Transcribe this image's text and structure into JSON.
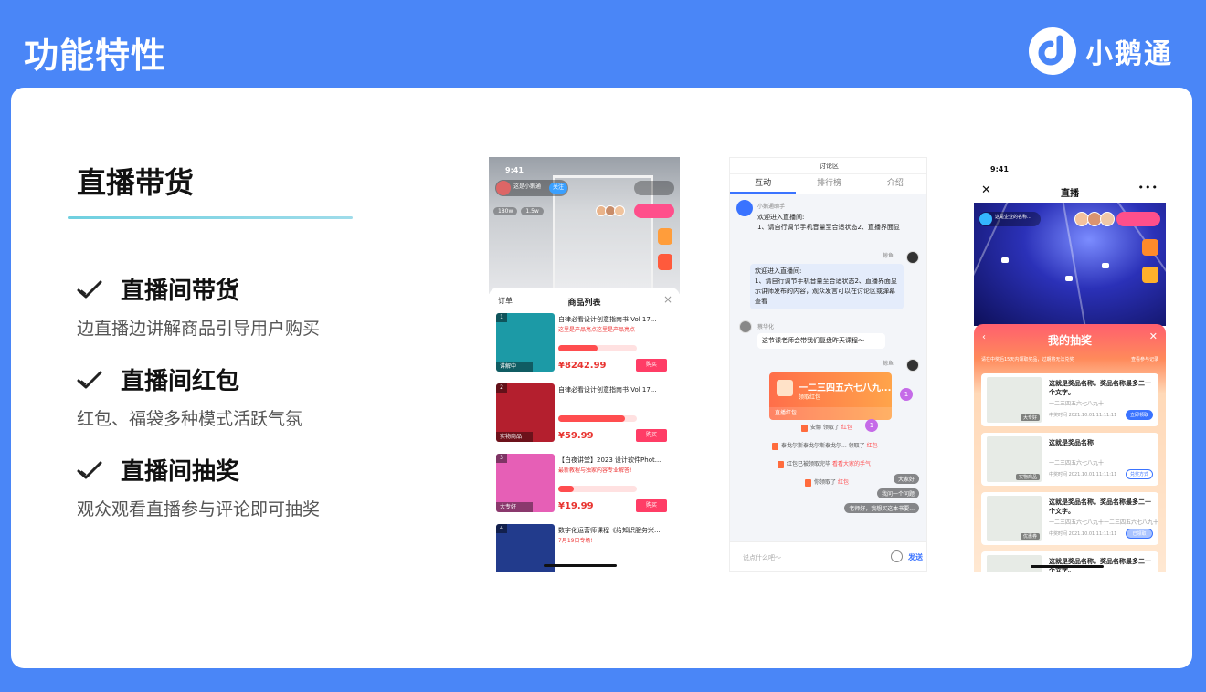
{
  "header": {
    "title": "功能特性",
    "brand_name": "小鹅通"
  },
  "section": {
    "title": "直播带货"
  },
  "features": [
    {
      "title": "直播间带货",
      "desc": "边直播边讲解商品引导用户购买"
    },
    {
      "title": "直播间红包",
      "desc": "红包、福袋多种模式活跃气氛"
    },
    {
      "title": "直播间抽奖",
      "desc": "观众观看直播参与评论即可抽奖"
    }
  ],
  "phone1": {
    "time": "9:41",
    "host_name": "这是小鹅通",
    "follow": "关注",
    "stats": [
      "180w",
      "1.5w"
    ],
    "order_label": "订单",
    "sheet_title": "商品列表",
    "products": [
      {
        "num": "1",
        "title": "自律必看设计创意指南书 Vol 17...",
        "sub": "这里是产品亮点这里是产品亮点",
        "price": "¥8242.99",
        "buy": "购买",
        "tag": "讲解中",
        "progress": 0.5,
        "color": "#1c9aa6"
      },
      {
        "num": "2",
        "title": "自律必看设计创意指南书 Vol 17...",
        "sub": "",
        "price": "¥59.99",
        "buy": "购买",
        "tag": "实物商品",
        "progress": 0.85,
        "color": "#b41f2e"
      },
      {
        "num": "3",
        "title": "【白夜讲堂】2023 设计软件Phot...",
        "sub": "最新教程与独家内容专业解答!",
        "price": "¥19.99",
        "buy": "购买",
        "tag": "大专好",
        "progress": 0.2,
        "color": "#e65fb6"
      },
      {
        "num": "4",
        "title": "数字化运营师课程《给知识服务兴...",
        "sub": "7月19日专场!",
        "price": "",
        "buy": "",
        "tag": "",
        "progress": 0,
        "color": "#223b8c"
      }
    ]
  },
  "phone2": {
    "title": "讨论区",
    "tabs": [
      "互动",
      "排行榜",
      "介绍"
    ],
    "bot_name": "小鹅通助手",
    "bot_msg1": "欢迎进入直播间:",
    "bot_msg2": "1、请自行调节手机音量至合适状态2、直播界面显",
    "user1_name": "鲸鱼",
    "blue_msg": "欢迎进入直播间:\n1、请自行调节手机音量至合适状态2、直播界面显示讲师发布的内容，观众发言可以在讨论区或弹幕查看",
    "user2_name": "蔡华化",
    "user2_msg": "这节课老师会带我们复盘昨天课程～",
    "user3_name": "鲸鱼",
    "redpack_title": "一二三四五六七八九...",
    "redpack_sub": "领取红包",
    "redpack_bottom": "直播红包",
    "sys1": "安娜 领取了",
    "sys2": "泰戈尔斯泰戈尔斯泰戈尔... 领取了",
    "sys3": "红包已被领取完毕",
    "sys3b": "看看大家的手气",
    "sys4": "你领取了",
    "red_word": "红包",
    "float1": "大家好",
    "float2": "我问一个问题",
    "float3": "老师好，我想买这本书要...",
    "input_placeholder": "说点什么吧～",
    "send": "发送",
    "badge": "1"
  },
  "phone3": {
    "time": "9:41",
    "nav_title": "直播",
    "info_name": "这是企业的名称...",
    "lottery_title": "我的抽奖",
    "note": "请在中奖后15天内领取奖品，过期将无法兑奖",
    "rules": "查看参与记录",
    "prizes": [
      {
        "title": "这就是奖品名称。奖品名称最多二十个文字。",
        "sub": "一二三四五六七八九十",
        "date": "中奖时间 2021.10.01 11:11:11",
        "button": "立即领取",
        "label": "大专好",
        "btn_bg": "#3a73ff",
        "btn_fg": "#ffffff"
      },
      {
        "title": "这就是奖品名称",
        "sub": "一二三四五六七八九十",
        "date": "中奖时间 2021.10.01 11:11:11",
        "button": "兑奖方式",
        "label": "实物商品",
        "btn_bg": "#ffffff",
        "btn_fg": "#3a73ff"
      },
      {
        "title": "这就是奖品名称。奖品名称最多二十个文字。",
        "sub": "一二三四五六七八九十一二三四五六七八九十",
        "date": "中奖时间 2021.10.01 11:11:11",
        "button": "已领取",
        "label": "优惠券",
        "btn_bg": "#a9c3ff",
        "btn_fg": "#ffffff"
      },
      {
        "title": "这就是奖品名称。奖品名称最多二十个文字。",
        "sub": "",
        "date": "",
        "button": "",
        "label": "",
        "btn_bg": "#ffffff",
        "btn_fg": "#3a73ff"
      }
    ]
  },
  "colors": {
    "background": "#4a86f7",
    "accent_blue": "#3a73ff",
    "underline": "#6fd0e0",
    "price_red": "#e8332f",
    "buy_pink": "#ff3d66"
  }
}
